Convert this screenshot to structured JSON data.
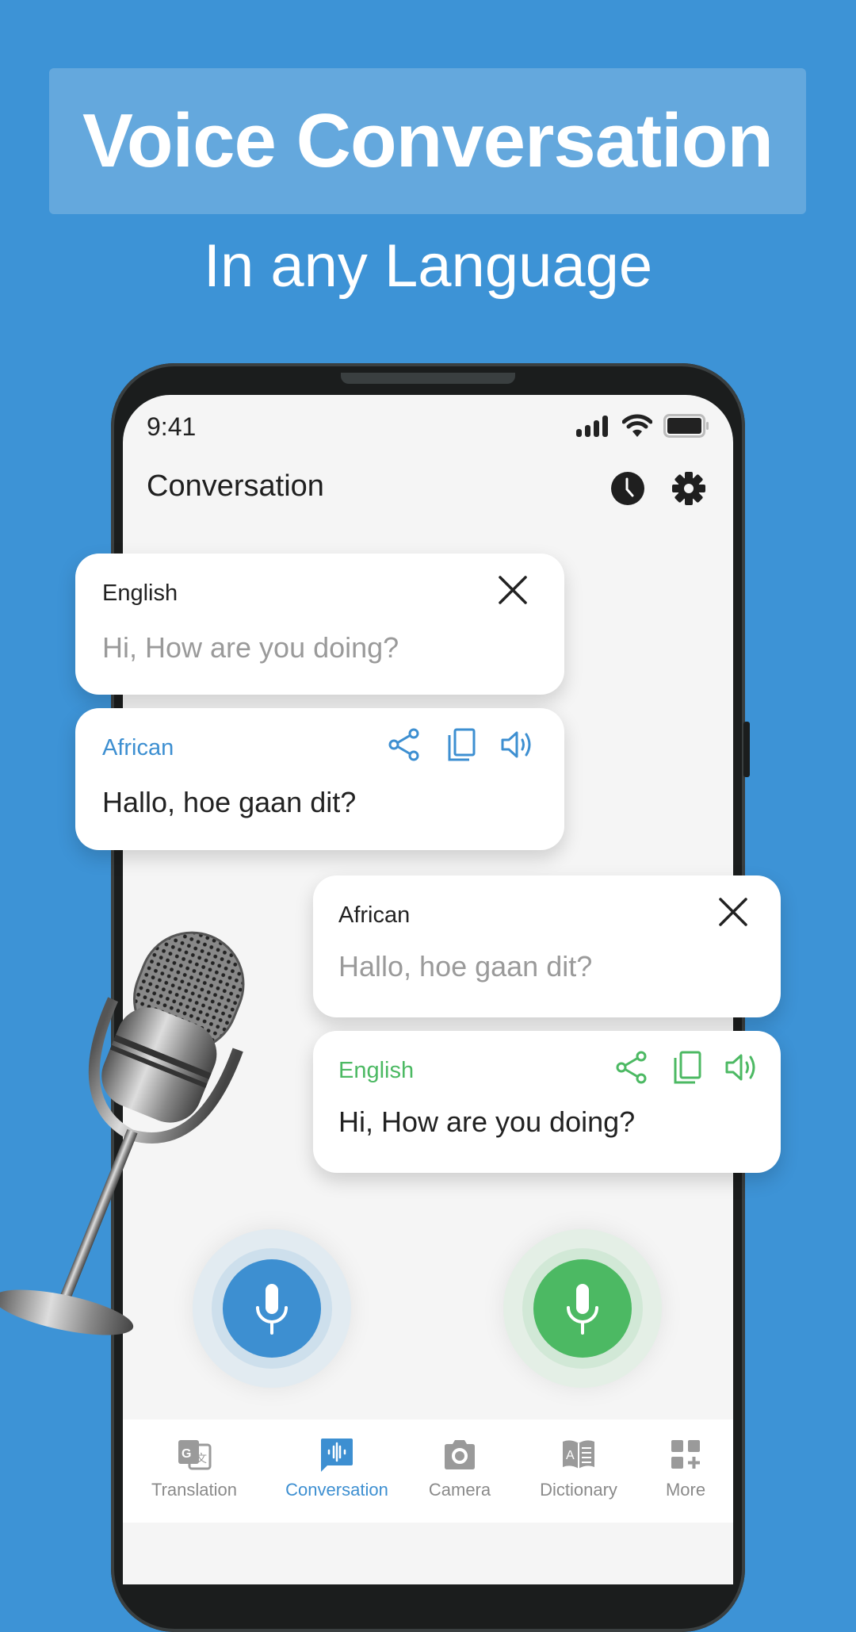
{
  "promo": {
    "headline": "Voice Conversation",
    "subtitle": "In any Language"
  },
  "status_bar": {
    "time": "9:41",
    "icons": [
      "signal-icon",
      "wifi-icon",
      "battery-icon"
    ]
  },
  "header": {
    "title": "Conversation",
    "actions": [
      "history-icon",
      "settings-icon"
    ]
  },
  "colors": {
    "background": "#3d93d6",
    "accent_blue": "#3d8fd1",
    "accent_green": "#4cb963",
    "screen_bg": "#f5f5f5"
  },
  "conversation": [
    {
      "input": {
        "language": "English",
        "text": "Hi, How are you doing?"
      },
      "output": {
        "language": "African",
        "text": "Hallo, hoe gaan dit?",
        "color": "blue"
      }
    },
    {
      "input": {
        "language": "African",
        "text": "Hallo, hoe gaan dit?"
      },
      "output": {
        "language": "English",
        "text": "Hi, How are you doing?",
        "color": "green"
      }
    }
  ],
  "mic_buttons": [
    {
      "side": "left",
      "color": "blue"
    },
    {
      "side": "right",
      "color": "green"
    }
  ],
  "bottom_nav": {
    "active": "Conversation",
    "items": [
      {
        "label": "Translation",
        "icon": "translate-icon"
      },
      {
        "label": "Conversation",
        "icon": "voice-chat-icon"
      },
      {
        "label": "Camera",
        "icon": "camera-icon"
      },
      {
        "label": "Dictionary",
        "icon": "dictionary-icon"
      },
      {
        "label": "More",
        "icon": "more-apps-icon"
      }
    ]
  }
}
